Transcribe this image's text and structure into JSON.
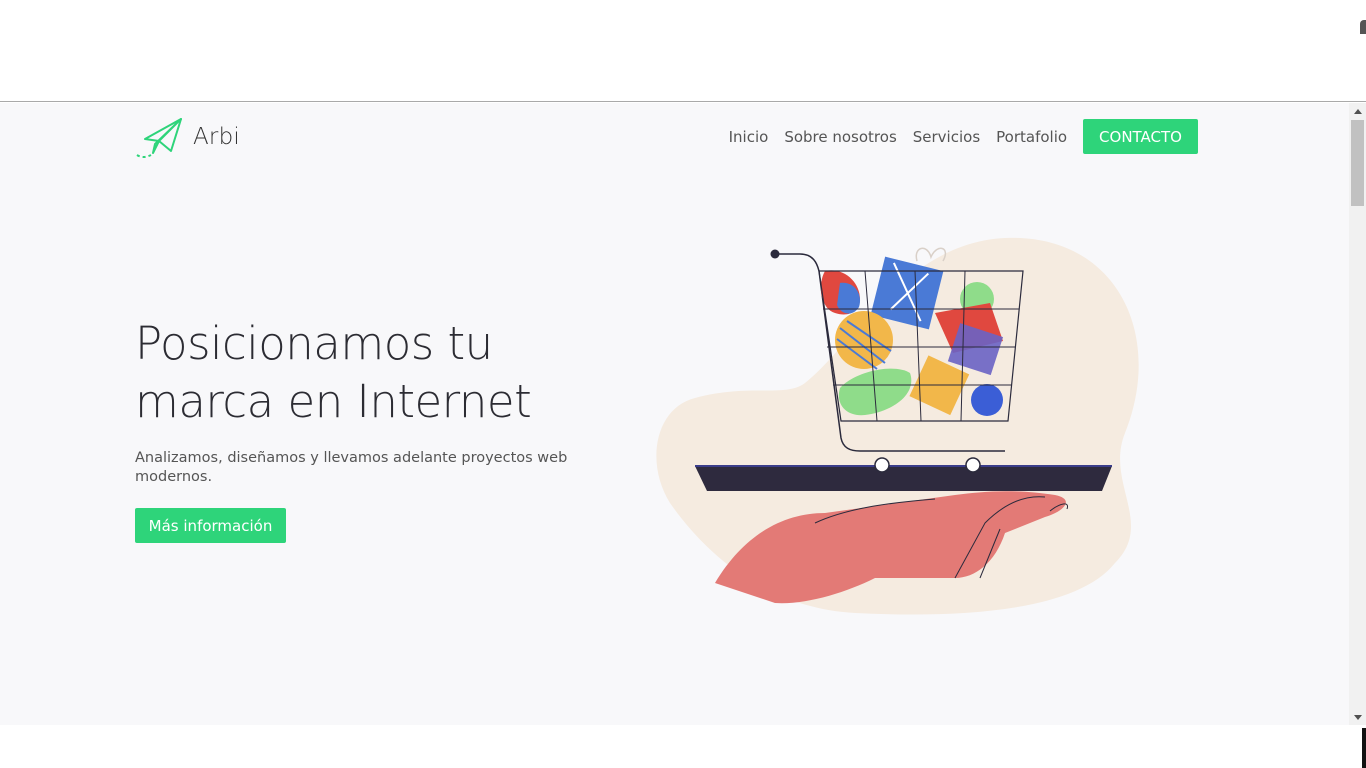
{
  "brand": {
    "name": "Arbi",
    "logo_icon": "paper-plane-icon"
  },
  "nav": {
    "links": [
      "Inicio",
      "Sobre nosotros",
      "Servicios",
      "Portafolio"
    ],
    "cta": "CONTACTO"
  },
  "hero": {
    "title": "Posicionamos tu marca en Internet",
    "subtitle": "Analizamos, diseñamos y llevamos adelante proyectos web modernos.",
    "button": "Más información",
    "illustration": "shopping-cart-on-tray-icon"
  },
  "colors": {
    "accent": "#2ed47a",
    "background": "#f8f8fa",
    "text": "#2c2c33"
  }
}
